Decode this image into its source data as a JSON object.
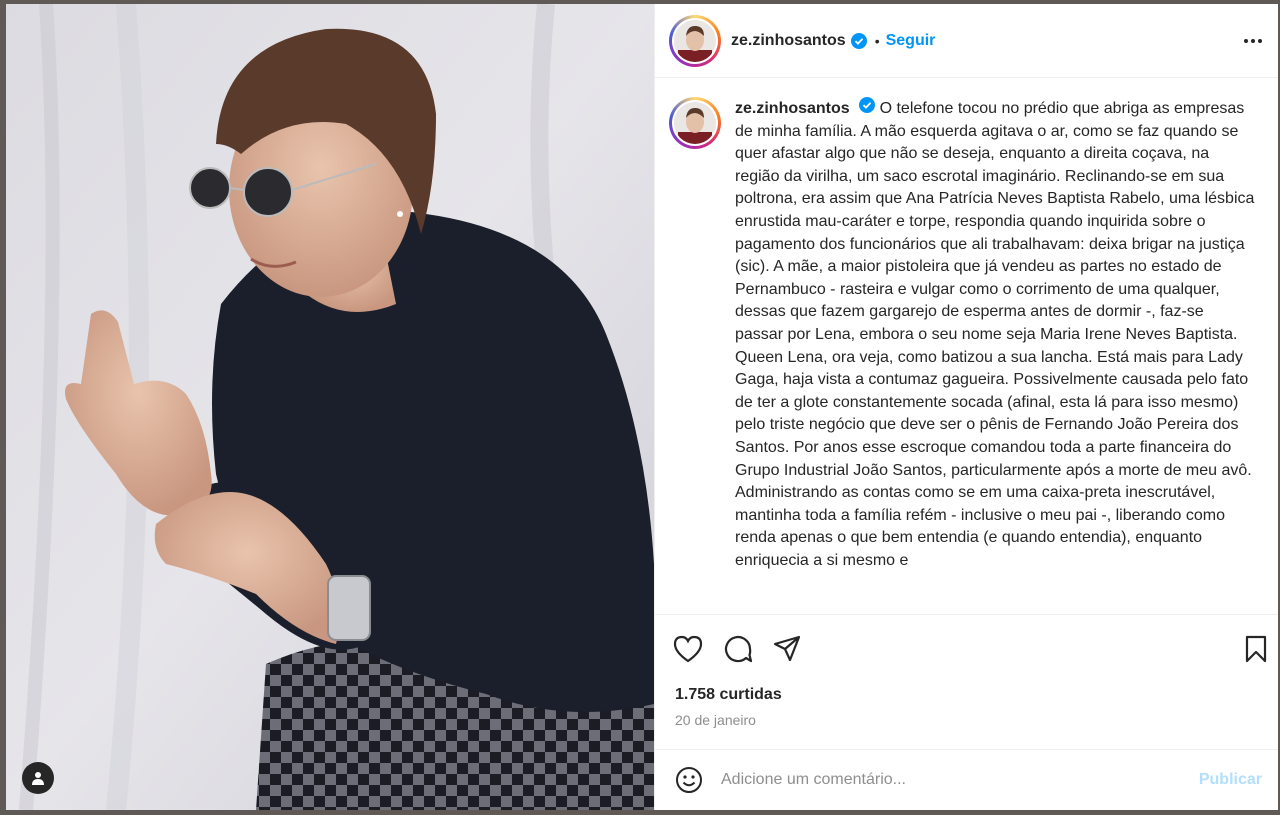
{
  "post": {
    "username": "ze.zinhosantos",
    "dot": "•",
    "follow_label": "Seguir",
    "caption": "O telefone tocou no prédio que abriga as empresas de minha família. A mão esquerda agitava o ar, como se faz quando se quer afastar algo que não se deseja, enquanto a direita coçava, na região da virilha, um saco escrotal imaginário. Reclinando-se em sua poltrona, era assim que Ana Patrícia Neves Baptista Rabelo, uma lésbica enrustida mau-caráter e torpe, respondia quando inquirida sobre o pagamento dos funcionários que ali trabalhavam: deixa brigar na justiça (sic). A mãe, a maior pistoleira que já vendeu as partes no estado de Pernambuco - rasteira e vulgar como o corrimento de uma qualquer, dessas que fazem gargarejo de esperma antes de dormir -, faz-se passar por Lena, embora o seu nome seja Maria Irene Neves Baptista. Queen Lena, ora veja, como batizou a sua lancha. Está mais para Lady Gaga, haja vista a contumaz gagueira. Possivelmente causada pelo fato de ter a glote constantemente socada (afinal, esta lá para isso mesmo) pelo triste negócio que deve ser o pênis de Fernando João Pereira dos Santos. Por anos esse escroque comandou toda a parte financeira do Grupo Industrial João Santos, particularmente após a morte de meu avô. Administrando as contas como se em uma caixa-preta inescrutável, mantinha toda a família refém - inclusive o meu pai -, liberando como renda apenas o que bem entendia (e quando entendia), enquanto enriquecia a si mesmo e",
    "likes": "1.758 curtidas",
    "date": "20 de janeiro"
  },
  "comment": {
    "placeholder": "Adicione um comentário...",
    "publish_label": "Publicar"
  },
  "colors": {
    "accent": "#0095f6",
    "publish_disabled": "#b2dffc",
    "text": "#262626",
    "muted": "#8e8e8e"
  },
  "icons": [
    "verified-badge-icon",
    "more-options-icon",
    "heart-icon",
    "comment-icon",
    "share-icon",
    "bookmark-icon",
    "emoji-icon",
    "user-tag-icon"
  ]
}
